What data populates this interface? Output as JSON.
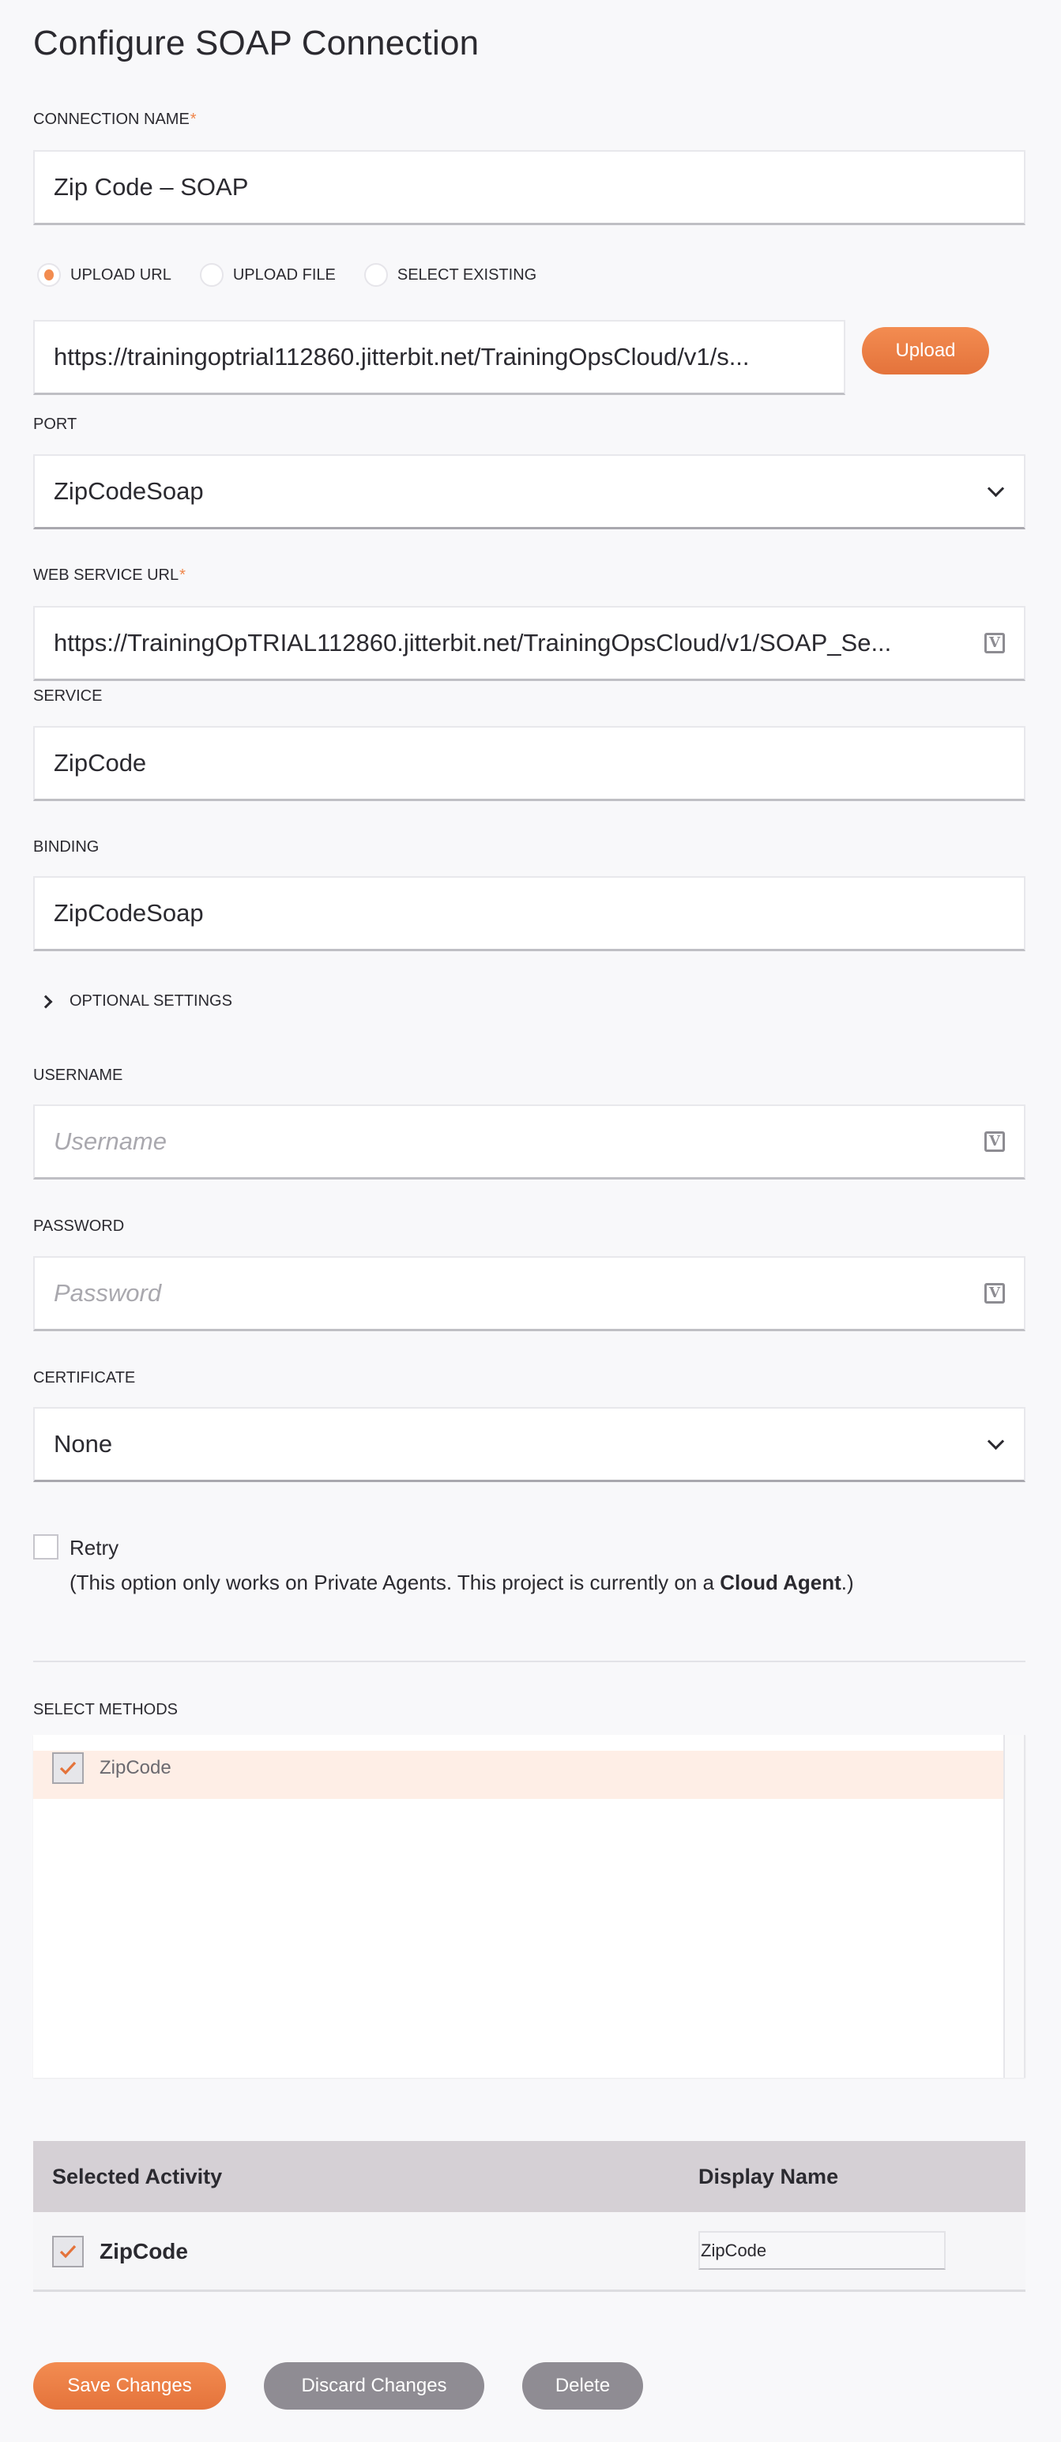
{
  "page": {
    "title": "Configure SOAP Connection"
  },
  "connection_name": {
    "label": "CONNECTION NAME",
    "required_marker": "*",
    "value": "Zip Code – SOAP"
  },
  "source_options": {
    "options": [
      {
        "label": "UPLOAD URL",
        "selected": true
      },
      {
        "label": "UPLOAD FILE",
        "selected": false
      },
      {
        "label": "SELECT EXISTING",
        "selected": false
      }
    ]
  },
  "upload_url": {
    "value": "https://trainingoptrial112860.jitterbit.net/TrainingOpsCloud/v1/s...",
    "button_label": "Upload"
  },
  "port": {
    "label": "PORT",
    "value": "ZipCodeSoap",
    "icon": "chevron-down-icon"
  },
  "web_service_url": {
    "label": "WEB SERVICE URL",
    "required_marker": "*",
    "value": "https://TrainingOpTRIAL112860.jitterbit.net/TrainingOpsCloud/v1/SOAP_Se...",
    "icon": "variable-icon",
    "icon_glyph": "V"
  },
  "service": {
    "label": "SERVICE",
    "value": "ZipCode"
  },
  "binding": {
    "label": "BINDING",
    "value": "ZipCodeSoap"
  },
  "optional_settings": {
    "label": "OPTIONAL SETTINGS",
    "expanded": false
  },
  "username": {
    "label": "USERNAME",
    "placeholder": "Username",
    "value": "",
    "icon_glyph": "V"
  },
  "password": {
    "label": "PASSWORD",
    "placeholder": "Password",
    "value": "",
    "icon_glyph": "V"
  },
  "certificate": {
    "label": "CERTIFICATE",
    "value": "None"
  },
  "retry": {
    "label": "Retry",
    "checked": false,
    "note_prefix": "(This option only works on Private Agents. This project is currently on a ",
    "note_bold": "Cloud Agent",
    "note_suffix": ".)"
  },
  "select_methods": {
    "label": "SELECT METHODS",
    "items": [
      {
        "label": "ZipCode",
        "checked": true,
        "highlighted": true
      }
    ]
  },
  "selected_activities": {
    "columns": [
      "Selected Activity",
      "Display Name"
    ],
    "rows": [
      {
        "activity": "ZipCode",
        "checked": true,
        "display_name": "ZipCode"
      }
    ]
  },
  "footer": {
    "save_label": "Save Changes",
    "discard_label": "Discard Changes",
    "delete_label": "Delete"
  },
  "colors": {
    "accent": "#F28C50",
    "accent_dark": "#E4733B",
    "secondary_button": "#8F8C93",
    "highlight_row": "#FEEEE6",
    "table_header": "#D5D0D5",
    "background": "#F8F8FA"
  }
}
